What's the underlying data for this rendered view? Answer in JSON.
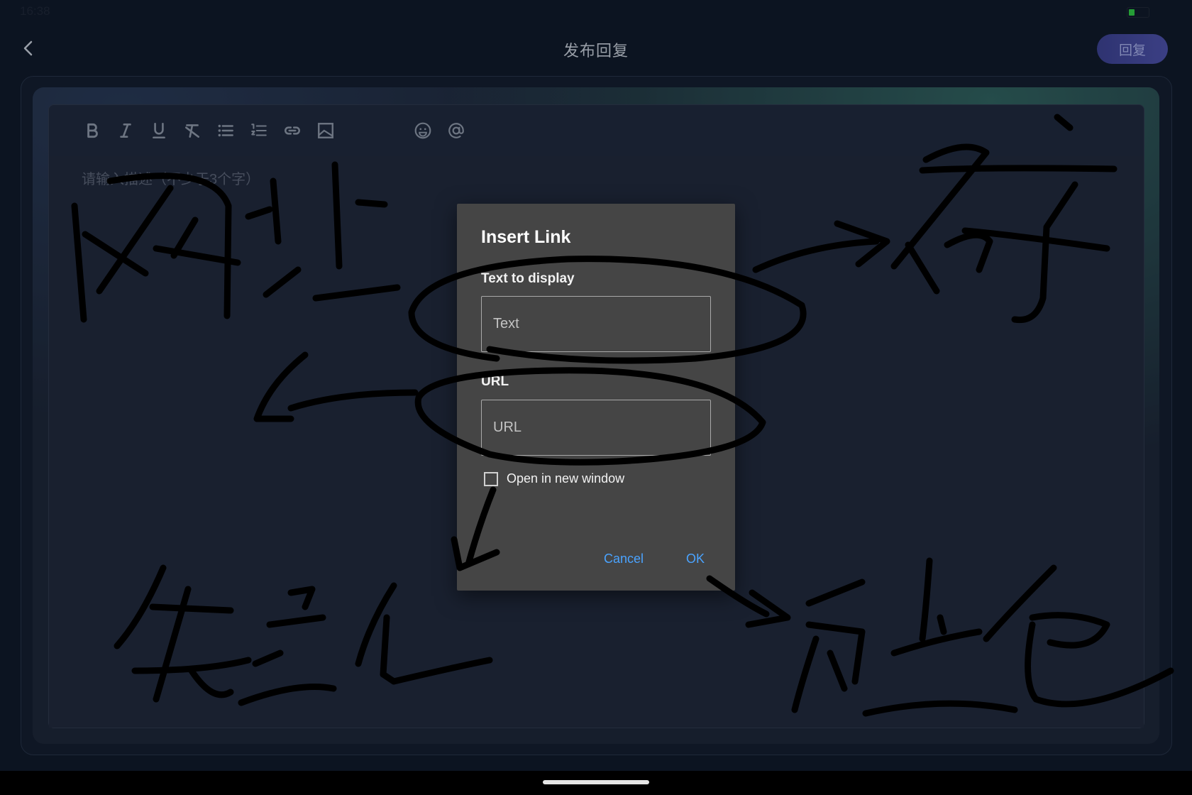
{
  "status_bar": {
    "time": "16:38"
  },
  "nav": {
    "title": "发布回复",
    "reply_label": "回复"
  },
  "editor": {
    "placeholder": "请输入描述（不少于3个字）",
    "toolbar_icons": [
      "bold-icon",
      "italic-icon",
      "underline-icon",
      "clear-format-icon",
      "bullet-list-icon",
      "numbered-list-icon",
      "link-icon",
      "image-icon",
      "emoji-icon",
      "mention-icon"
    ]
  },
  "dialog": {
    "title": "Insert Link",
    "text_label": "Text to display",
    "text_placeholder": "Text",
    "text_value": "",
    "url_label": "URL",
    "url_placeholder": "URL",
    "url_value": "",
    "open_new_window_label": "Open in new window",
    "open_new_window_checked": false,
    "cancel_label": "Cancel",
    "ok_label": "OK"
  },
  "colors": {
    "accent_link": "#4aa3ff",
    "reply_button": "#3f4496",
    "dialog_bg": "#454545"
  }
}
